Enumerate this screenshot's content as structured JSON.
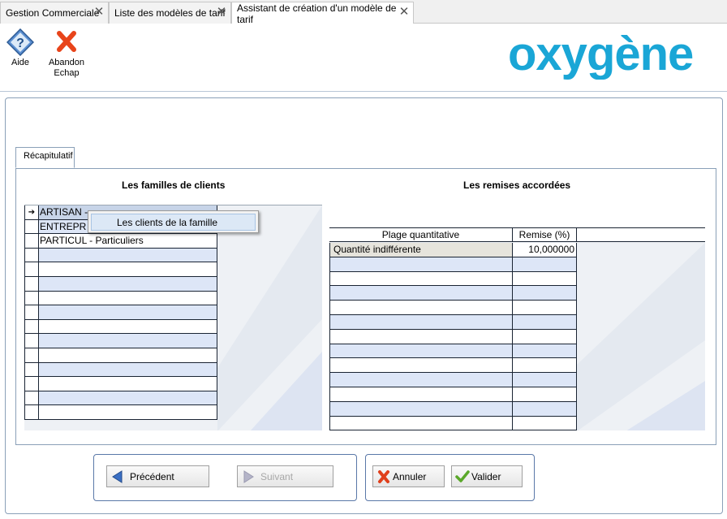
{
  "tabs": [
    {
      "label": "Gestion Commerciale",
      "active": false
    },
    {
      "label": "Liste des modèles de tarif",
      "active": false
    },
    {
      "label": "Assistant de création d'un modèle de tarif",
      "active": true
    }
  ],
  "toolbar": {
    "help_label": "Aide",
    "abandon_label_1": "Abandon",
    "abandon_label_2": "Echap"
  },
  "logo": {
    "text": "oxygène",
    "color": "#1aa6d6"
  },
  "inner_tab": {
    "label": "Récapitulatif"
  },
  "left_section": {
    "title": "Les familles de clients",
    "rows": [
      {
        "indicator": "➔",
        "text": "ARTISAN - "
      },
      {
        "indicator": "",
        "text": "ENTREPR"
      },
      {
        "indicator": "",
        "text": "PARTICUL - Particuliers"
      },
      {
        "indicator": "",
        "text": ""
      },
      {
        "indicator": "",
        "text": ""
      },
      {
        "indicator": "",
        "text": ""
      },
      {
        "indicator": "",
        "text": ""
      },
      {
        "indicator": "",
        "text": ""
      },
      {
        "indicator": "",
        "text": ""
      },
      {
        "indicator": "",
        "text": ""
      },
      {
        "indicator": "",
        "text": ""
      },
      {
        "indicator": "",
        "text": ""
      },
      {
        "indicator": "",
        "text": ""
      },
      {
        "indicator": "",
        "text": ""
      },
      {
        "indicator": "",
        "text": ""
      }
    ]
  },
  "context_menu": {
    "item": "Les clients de la famille"
  },
  "right_section": {
    "title": "Les remises accordées",
    "col_range": "Plage quantitative",
    "col_discount": "Remise (%)",
    "rows": [
      {
        "range": "Quantité indifférente",
        "discount": "10,000000"
      },
      {
        "range": "",
        "discount": ""
      },
      {
        "range": "",
        "discount": ""
      },
      {
        "range": "",
        "discount": ""
      },
      {
        "range": "",
        "discount": ""
      },
      {
        "range": "",
        "discount": ""
      },
      {
        "range": "",
        "discount": ""
      },
      {
        "range": "",
        "discount": ""
      },
      {
        "range": "",
        "discount": ""
      },
      {
        "range": "",
        "discount": ""
      },
      {
        "range": "",
        "discount": ""
      },
      {
        "range": "",
        "discount": ""
      },
      {
        "range": "",
        "discount": ""
      }
    ]
  },
  "buttons": {
    "previous": "Précédent",
    "next": "Suivant",
    "cancel": "Annuler",
    "validate": "Valider"
  },
  "colors": {
    "row_alt": "#dde6f7",
    "row_selected": "#c7d4e8",
    "row_first_right": "#e6e4dc",
    "frame_border": "#8aa0b8"
  }
}
